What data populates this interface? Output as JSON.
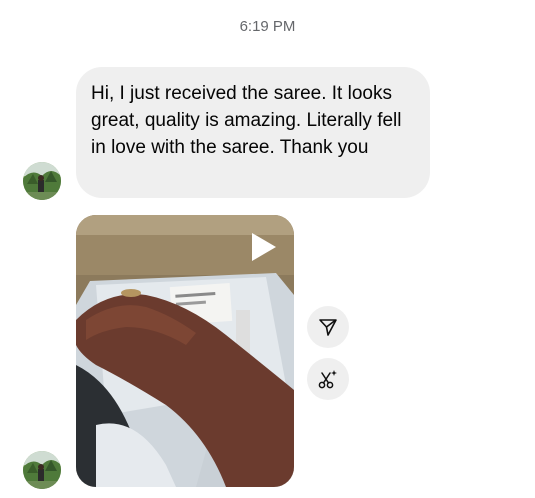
{
  "thread": {
    "timestamp": "6:19 PM",
    "messages": [
      {
        "type": "text",
        "sender": "contact",
        "text": "Hi, I just received the saree. It looks great, quality is amazing. Literally fell in love with the saree. Thank you"
      },
      {
        "type": "video",
        "sender": "contact",
        "thumbnail_icon": "play-icon",
        "actions": [
          "share-icon",
          "ai-effects-icon"
        ]
      }
    ]
  }
}
